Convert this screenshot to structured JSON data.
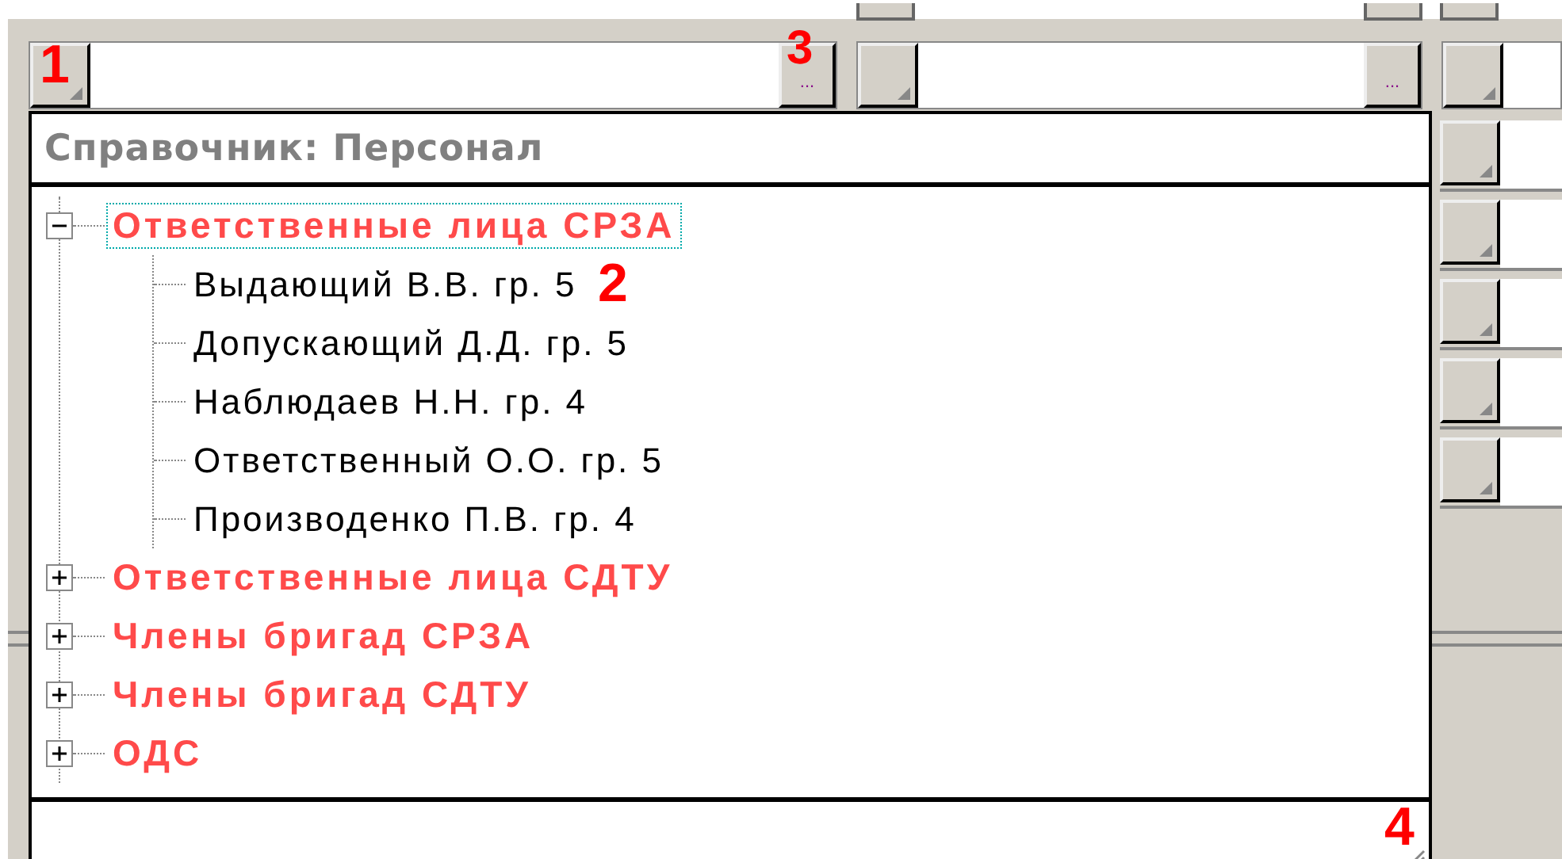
{
  "top_row": [
    {
      "kind": "lookup",
      "lookup_button": "..."
    },
    {
      "kind": "lookup",
      "lookup_button": "..."
    },
    {
      "kind": "plain"
    }
  ],
  "side_rows": [
    {
      "kind": "field"
    },
    {
      "kind": "field"
    },
    {
      "kind": "field"
    },
    {
      "kind": "field"
    },
    {
      "kind": "field"
    }
  ],
  "dropdown": {
    "title": "Справочник: Персонал",
    "tree": [
      {
        "label": "Ответственные лица СРЗА",
        "kind": "group",
        "expanded": true,
        "selected": true,
        "children": [
          {
            "label": "Выдающий В.В. гр. 5",
            "kind": "person",
            "selected": false
          },
          {
            "label": "Допускающий Д.Д. гр. 5",
            "kind": "person",
            "selected": false
          },
          {
            "label": "Наблюдаев Н.Н. гр. 4",
            "kind": "person",
            "selected": false
          },
          {
            "label": "Ответственный О.О. гр. 5",
            "kind": "person",
            "selected": false
          },
          {
            "label": "Производенко П.В. гр. 4",
            "kind": "person",
            "selected": false
          }
        ]
      },
      {
        "label": "Ответственные лица СДТУ",
        "kind": "group",
        "expanded": false,
        "selected": false
      },
      {
        "label": "Члены бригад СРЗА",
        "kind": "group",
        "expanded": false,
        "selected": false
      },
      {
        "label": "Члены бригад СДТУ",
        "kind": "group",
        "expanded": false,
        "selected": false
      },
      {
        "label": "ОДС",
        "kind": "group",
        "expanded": false,
        "selected": false
      }
    ]
  },
  "markers": [
    "1",
    "2",
    "3",
    "4"
  ]
}
